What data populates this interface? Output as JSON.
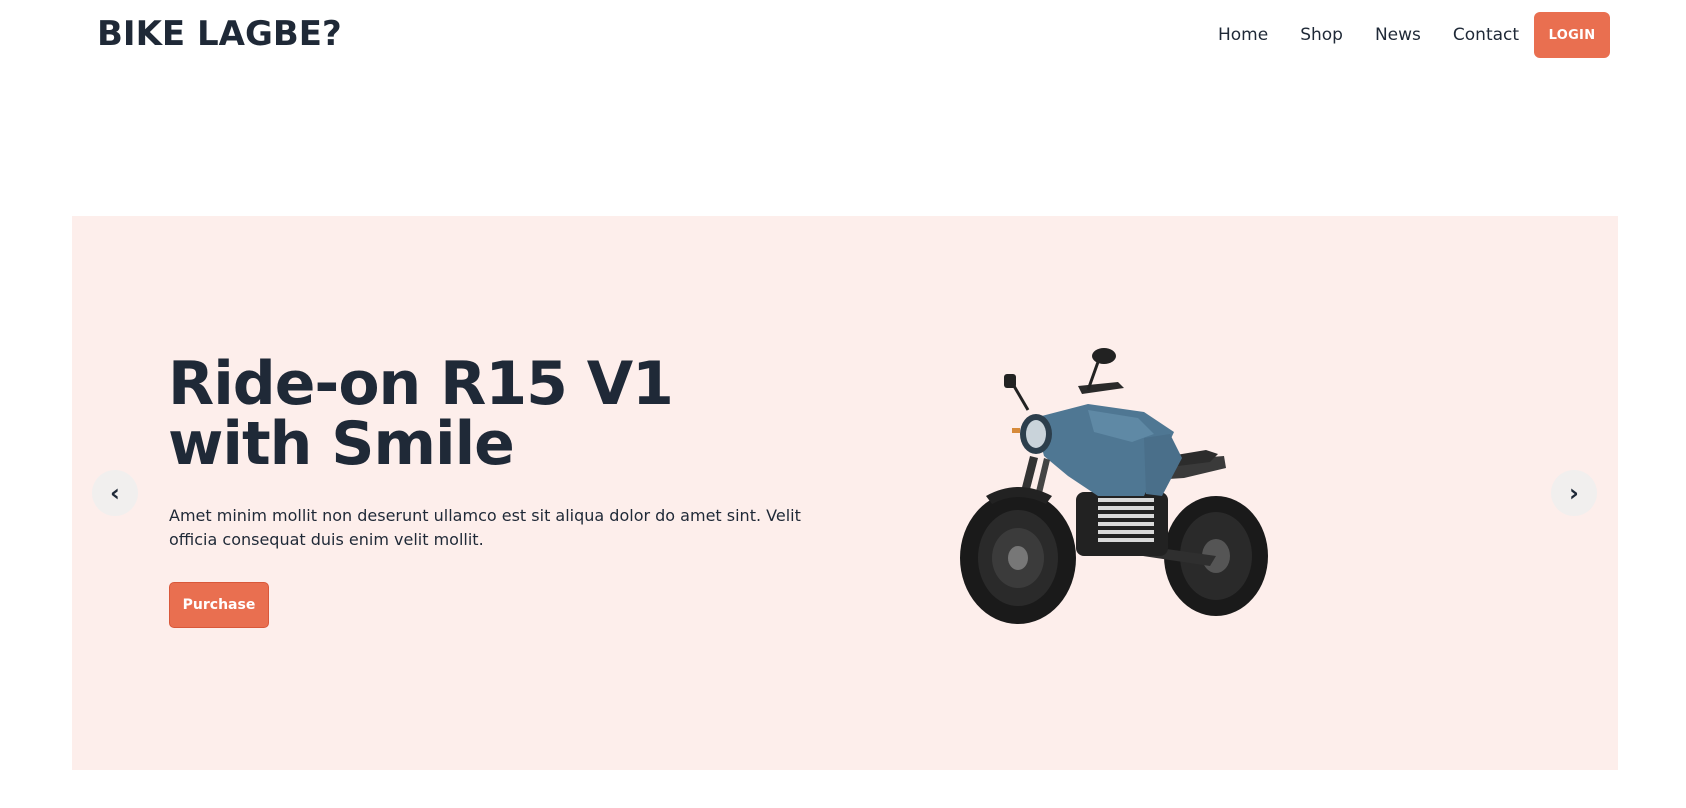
{
  "brand": {
    "name": "BIKE LAGBE?"
  },
  "nav": {
    "links": [
      "Home",
      "Shop",
      "News",
      "Contact"
    ],
    "login_label": "LOGIN"
  },
  "hero": {
    "title_line1": "Ride-on R15 V1",
    "title_line2": "with Smile",
    "description": "Amet minim mollit non deserunt ullamco est sit aliqua dolor do amet sint. Velit officia consequat duis enim velit mollit.",
    "purchase_label": "Purchase",
    "prev_arrow": "‹",
    "next_arrow": "›",
    "image_icon": "motorcycle-image"
  },
  "colors": {
    "accent": "#e96f50",
    "hero_bg": "#fdeeeb",
    "text": "#1f2937",
    "bike_body": "#4f7793"
  }
}
